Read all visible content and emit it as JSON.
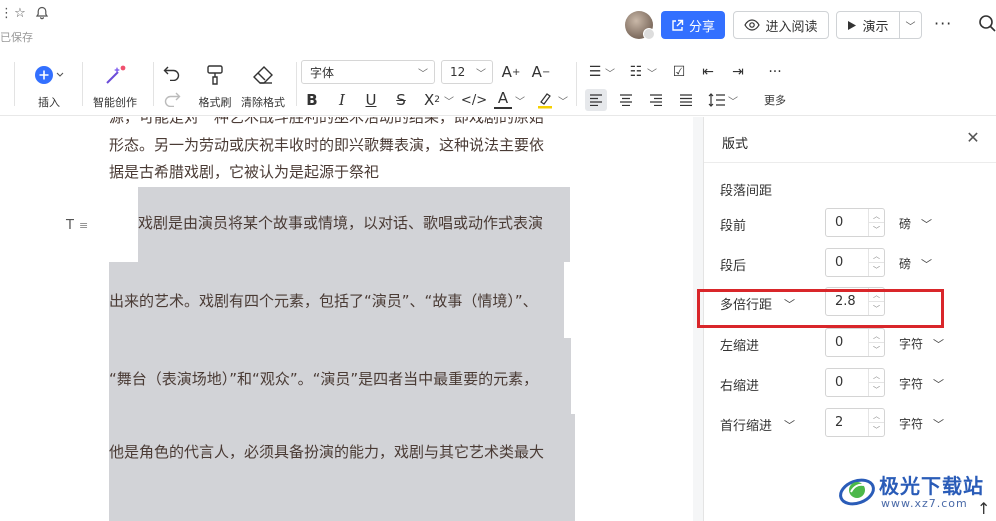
{
  "header": {
    "saved_status": "已保存",
    "share_label": "分享",
    "read_label": "进入阅读",
    "present_label": "演示"
  },
  "toolbar": {
    "insert_label": "插入",
    "ai_create_label": "智能创作",
    "format_brush_label": "格式刷",
    "clear_format_label": "清除格式",
    "font_family": "字体",
    "font_size": "12",
    "more_label": "更多"
  },
  "document": {
    "paragraph1_lines": [
      "源，可能是对一种艺术战斗胜利的巫术活动的结果，即戏剧的原始",
      "形态。另一为劳动或庆祝丰收时的即兴歌舞表演，这种说法主要依",
      "据是古希腊戏剧，它被认为是起源于祭祀"
    ],
    "paragraph2_lines": [
      "戏剧是由演员将某个故事或情境，以对话、歌唱或动作式表演",
      "出来的艺术。戏剧有四个元素，包括了“演员”、“故事（情境）”、",
      "“舞台（表演场地）”和“观众”。“演员”是四者当中最重要的元素，",
      "他是角色的代言人，必须具备扮演的能力，戏剧与其它艺术类最大"
    ]
  },
  "panel": {
    "title": "版式",
    "section_label": "段落间距",
    "rows": [
      {
        "label": "段前",
        "value": "0",
        "unit": "磅"
      },
      {
        "label": "段后",
        "value": "0",
        "unit": "磅"
      },
      {
        "label": "多倍行距",
        "value": "2.8",
        "unit": ""
      },
      {
        "label": "左缩进",
        "value": "0",
        "unit": "字符"
      },
      {
        "label": "右缩进",
        "value": "0",
        "unit": "字符"
      },
      {
        "label": "首行缩进",
        "value": "2",
        "unit": "字符"
      }
    ]
  },
  "watermark": {
    "title": "极光下载站",
    "url": "www.xz7.com"
  },
  "colors": {
    "accent": "#3370ff",
    "highlight": "#d2d3d7",
    "annotation_red": "#d9262a"
  }
}
